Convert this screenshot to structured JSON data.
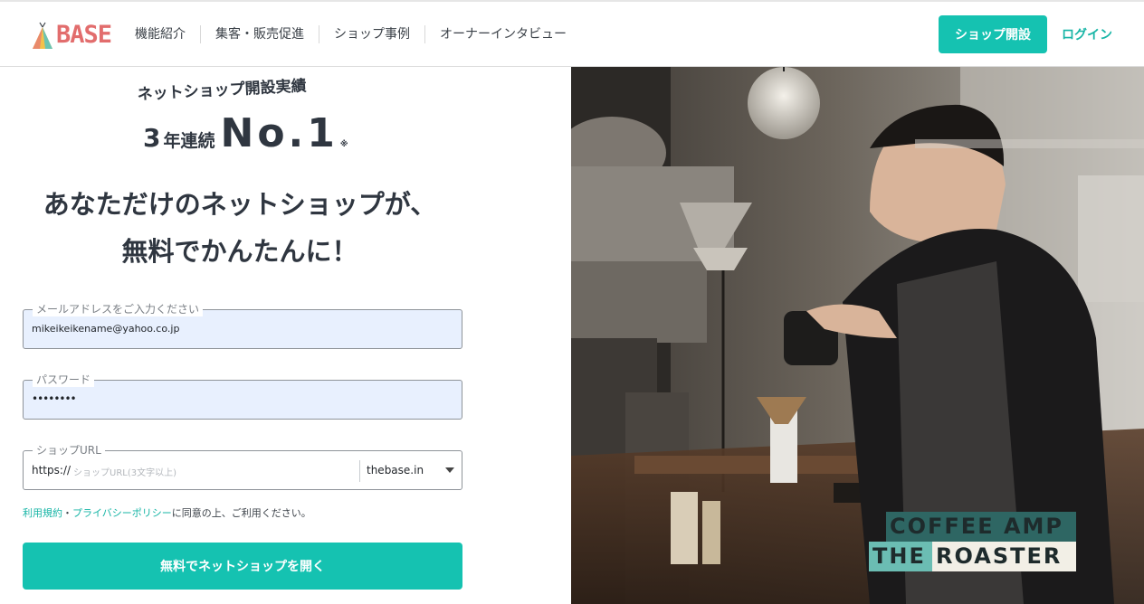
{
  "header": {
    "logo_text": "BASE",
    "nav": [
      "機能紹介",
      "集客・販売促進",
      "ショップ事例",
      "オーナーインタビュー"
    ],
    "open_shop_label": "ショップ開設",
    "login_label": "ログイン"
  },
  "badge": {
    "line1": "ネットショップ開設実績",
    "years_num": "3",
    "years_text": "年連続",
    "no1": "No.1",
    "note": "※"
  },
  "headline": {
    "line1": "あなただけのネットショップが、",
    "line2": "無料でかんたんに！"
  },
  "form": {
    "email_label": "メールアドレスをご入力ください",
    "email_value": "mikeikeikename@yahoo.co.jp",
    "password_label": "パスワード",
    "password_value": "••••••••",
    "url_label": "ショップURL",
    "url_prefix": "https://",
    "url_placeholder": "ショップURL(3文字以上)",
    "url_domain": "thebase.in",
    "terms_link1": "利用規約",
    "terms_sep": "・",
    "terms_link2": "プライバシーポリシー",
    "terms_rest": "に同意の上、ご利用ください。",
    "submit_label": "無料でネットショップを開く"
  },
  "photo": {
    "sign_line1": "COFFEE AMP",
    "sign_line2a": "THE",
    "sign_line2b": "ROASTER",
    "sign_dark": "#2e6663",
    "sign_teal": "#6bbdb3"
  }
}
